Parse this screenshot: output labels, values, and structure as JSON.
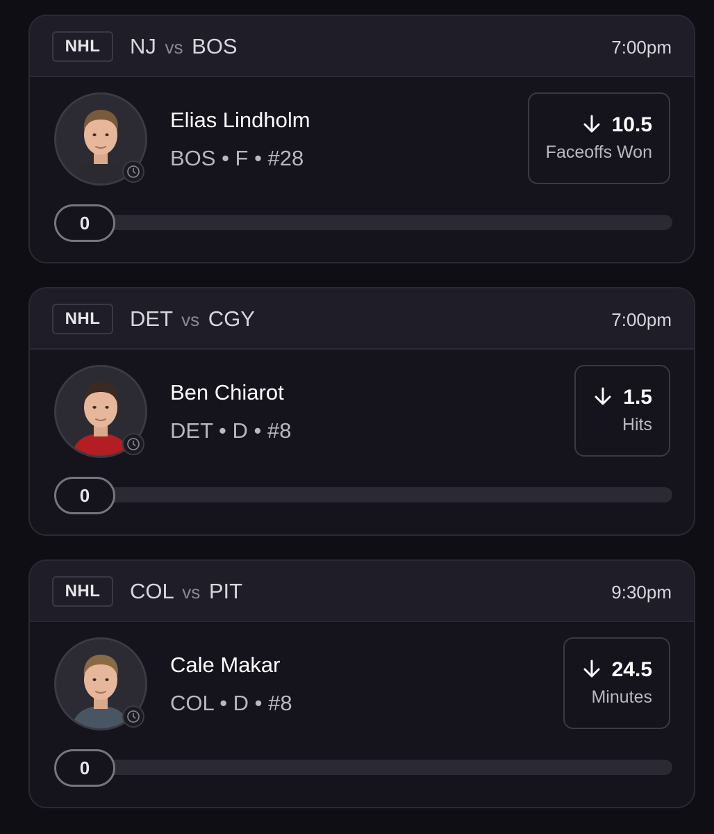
{
  "cards": [
    {
      "league": "NHL",
      "team_a": "NJ",
      "vs": "vs",
      "team_b": "BOS",
      "time": "7:00pm",
      "player": {
        "name": "Elias Lindholm",
        "meta": "BOS • F • #28",
        "jersey": "#2b2a31",
        "hair": "#7a5a3c"
      },
      "projection": {
        "direction": "down",
        "value": "10.5",
        "stat": "Faceoffs Won"
      },
      "progress": {
        "count": "0",
        "fraction": 0
      }
    },
    {
      "league": "NHL",
      "team_a": "DET",
      "vs": "vs",
      "team_b": "CGY",
      "time": "7:00pm",
      "player": {
        "name": "Ben Chiarot",
        "meta": "DET • D • #8",
        "jersey": "#b21e23",
        "hair": "#3a2a22"
      },
      "projection": {
        "direction": "down",
        "value": "1.5",
        "stat": "Hits"
      },
      "progress": {
        "count": "0",
        "fraction": 0
      }
    },
    {
      "league": "NHL",
      "team_a": "COL",
      "vs": "vs",
      "team_b": "PIT",
      "time": "9:30pm",
      "player": {
        "name": "Cale Makar",
        "meta": "COL • D • #8",
        "jersey": "#4a5563",
        "hair": "#8a6a45"
      },
      "projection": {
        "direction": "down",
        "value": "24.5",
        "stat": "Minutes"
      },
      "progress": {
        "count": "0",
        "fraction": 0
      }
    }
  ],
  "icons": {
    "direction": "arrow-down-icon",
    "clock": "clock-icon"
  }
}
